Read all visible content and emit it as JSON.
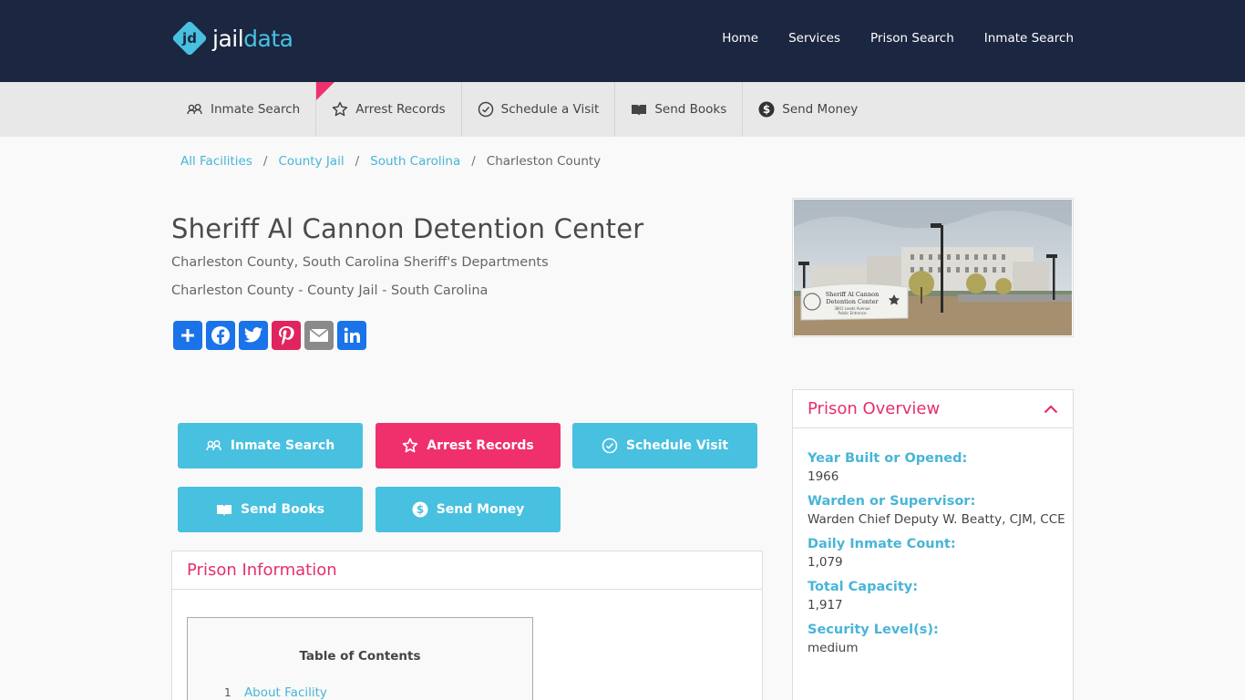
{
  "brand": {
    "mark": "jd",
    "name_a": "jail",
    "name_b": "data"
  },
  "topnav": [
    {
      "label": "Home"
    },
    {
      "label": "Services"
    },
    {
      "label": "Prison Search"
    },
    {
      "label": "Inmate Search"
    }
  ],
  "subnav": [
    {
      "label": "Inmate Search",
      "icon": "people-search-icon"
    },
    {
      "label": "Arrest Records",
      "icon": "star-badge-icon"
    },
    {
      "label": "Schedule a Visit",
      "icon": "clock-icon"
    },
    {
      "label": "Send Books",
      "icon": "book-icon"
    },
    {
      "label": "Send Money",
      "icon": "dollar-icon"
    }
  ],
  "breadcrumb": {
    "items": [
      "All Facilities",
      "County Jail",
      "South Carolina"
    ],
    "current": "Charleston County",
    "separator": "/"
  },
  "facility": {
    "title": "Sheriff Al Cannon Detention Center",
    "subtitle": "Charleston County, South Carolina Sheriff's Departments",
    "location": "Charleston County - County Jail - South Carolina",
    "photo_sign": [
      "Sheriff Al Cannon",
      "Detention Center",
      "3841 Leeds Avenue",
      "Public Entrance"
    ]
  },
  "share": [
    {
      "name": "share-button",
      "color": "#1a73e8"
    },
    {
      "name": "facebook-button",
      "color": "#1a73e8"
    },
    {
      "name": "twitter-button",
      "color": "#1a73e8"
    },
    {
      "name": "pinterest-button",
      "color": "#e0245e"
    },
    {
      "name": "email-button",
      "color": "#8a8a8a"
    },
    {
      "name": "linkedin-button",
      "color": "#1a73e8"
    }
  ],
  "actions": {
    "inmate_search": "Inmate Search",
    "arrest_records": "Arrest Records",
    "schedule_visit": "Schedule Visit",
    "send_books": "Send Books",
    "send_money": "Send Money"
  },
  "prison_info": {
    "heading": "Prison Information",
    "toc_title": "Table of Contents",
    "toc_items": [
      {
        "num": "1",
        "label": "About Facility"
      }
    ]
  },
  "overview": {
    "heading": "Prison Overview",
    "fields": [
      {
        "label": "Year Built or Opened:",
        "value": "1966"
      },
      {
        "label": "Warden or Supervisor:",
        "value": "Warden Chief Deputy W. Beatty, CJM, CCE"
      },
      {
        "label": "Daily Inmate Count:",
        "value": "1,079"
      },
      {
        "label": "Total Capacity:",
        "value": "1,917"
      },
      {
        "label": "Security Level(s):",
        "value": "medium"
      }
    ]
  },
  "colors": {
    "header_bg": "#1b2640",
    "accent_blue": "#48c0e0",
    "accent_pink": "#f0306c",
    "subnav_bg": "#e8e8e8"
  }
}
